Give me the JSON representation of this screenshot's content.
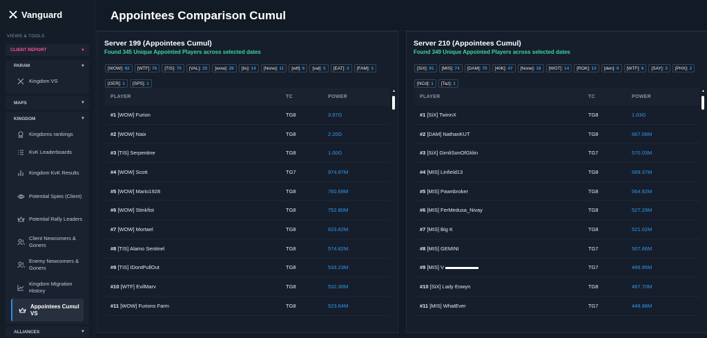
{
  "app": {
    "name": "Vanguard"
  },
  "sidebar": {
    "section_title": "VIEWS & TOOLS",
    "client_report": "CLIENT REPORT",
    "param": {
      "label": "PARAM",
      "items": [
        {
          "label": "Kingdom VS",
          "icon": "swords-icon"
        }
      ]
    },
    "maps": {
      "label": "MAPS"
    },
    "kingdom": {
      "label": "KINGDOM",
      "items": [
        {
          "label": "Kingdoms rankings",
          "icon": "award-icon"
        },
        {
          "label": "KvK Leaderboards",
          "icon": "list-icon"
        },
        {
          "label": "Kingdom KvK Results",
          "icon": "bar-chart-icon"
        },
        {
          "label": "Potential Spies (Client)",
          "icon": "eye-icon"
        },
        {
          "label": "Potential Rally Leaders",
          "icon": "crown-icon"
        },
        {
          "label": "Client Newcomers & Goners",
          "icon": "users-icon"
        },
        {
          "label": "Enemy Newcomers & Goners",
          "icon": "users-icon"
        },
        {
          "label": "Kingdom Migration History",
          "icon": "trend-icon"
        },
        {
          "label": "Appointees Cumul VS",
          "icon": "crown-icon",
          "active": true
        }
      ]
    },
    "alliances": {
      "label": "ALLIANCES"
    }
  },
  "header": {
    "title": "Appointees Comparison Cumul"
  },
  "columns": {
    "player": "PLAYER",
    "tc": "TC",
    "power": "POWER"
  },
  "panels": [
    {
      "title": "Server 199 (Appointees Cumul)",
      "found": "Found 345 Unique Appointed Players across selected dates",
      "tags": [
        {
          "name": "[WOW]:",
          "count": "92"
        },
        {
          "name": "[WTF]:",
          "count": "76"
        },
        {
          "name": "[TIS]:",
          "count": "70"
        },
        {
          "name": "[VAL]:",
          "count": "35"
        },
        {
          "name": "[wow]:",
          "count": "28"
        },
        {
          "name": "[tis]:",
          "count": "14"
        },
        {
          "name": "[None]:",
          "count": "11"
        },
        {
          "name": "[wtf]:",
          "count": "6"
        },
        {
          "name": "[val]:",
          "count": "5"
        },
        {
          "name": "[EAT]:",
          "count": "3"
        },
        {
          "name": "[FAM]:",
          "count": "3"
        },
        {
          "name": "[GER]:",
          "count": "1"
        },
        {
          "name": "[SPS]:",
          "count": "1"
        }
      ],
      "rows": [
        {
          "rank": "#1",
          "name": "[WOW] Furion",
          "tc": "TG8",
          "power": "3.97G"
        },
        {
          "rank": "#2",
          "name": "[WOW] Naix",
          "tc": "TG8",
          "power": "2.20G"
        },
        {
          "rank": "#3",
          "name": "[TIS] Serpentine",
          "tc": "TG8",
          "power": "1.00G"
        },
        {
          "rank": "#4",
          "name": "[WOW] Scott",
          "tc": "TG7",
          "power": "974.87M"
        },
        {
          "rank": "#5",
          "name": "[WOW] Mario1928",
          "tc": "TG8",
          "power": "760.69M"
        },
        {
          "rank": "#6",
          "name": "[WOW] Stinkfist",
          "tc": "TG8",
          "power": "752.80M"
        },
        {
          "rank": "#7",
          "name": "[WOW] Mortael",
          "tc": "TG8",
          "power": "623.82M"
        },
        {
          "rank": "#8",
          "name": "[TIS] Alamo Sentinel",
          "tc": "TG8",
          "power": "574.82M"
        },
        {
          "rank": "#9",
          "name": "[TIS] IDontPullOut",
          "tc": "TG8",
          "power": "533.23M"
        },
        {
          "rank": "#10",
          "name": "[WTF] EvilMarv",
          "tc": "TG8",
          "power": "532.30M"
        },
        {
          "rank": "#11",
          "name": "[WOW] Furions Farm",
          "tc": "TG8",
          "power": "523.64M"
        }
      ]
    },
    {
      "title": "Server 210 (Appointees Cumul)",
      "found": "Found 349 Unique Appointed Players across selected dates",
      "tags": [
        {
          "name": "[SiX]:",
          "count": "91"
        },
        {
          "name": "[MIS]:",
          "count": "74"
        },
        {
          "name": "[DAM]:",
          "count": "70"
        },
        {
          "name": "[40K]:",
          "count": "47"
        },
        {
          "name": "[None]:",
          "count": "18"
        },
        {
          "name": "[WOT]:",
          "count": "14"
        },
        {
          "name": "[ROK]:",
          "count": "13"
        },
        {
          "name": "[den]:",
          "count": "9"
        },
        {
          "name": "[WTF]:",
          "count": "6"
        },
        {
          "name": "[SAY]:",
          "count": "3"
        },
        {
          "name": "[PHX]:",
          "count": "2"
        },
        {
          "name": "[NCd]:",
          "count": "1"
        },
        {
          "name": "[Taz]:",
          "count": "1"
        }
      ],
      "rows": [
        {
          "rank": "#1",
          "name": "[SiX] TwinnX",
          "tc": "TG8",
          "power": "1.03G"
        },
        {
          "rank": "#2",
          "name": "[DAM] NathanKUT",
          "tc": "TG8",
          "power": "667.08M"
        },
        {
          "rank": "#3",
          "name": "[SiX] GimliSonOfGlóin",
          "tc": "TG7",
          "power": "570.03M"
        },
        {
          "rank": "#4",
          "name": "[MIS] Linfield13",
          "tc": "TG8",
          "power": "569.37M"
        },
        {
          "rank": "#5",
          "name": "[MIS] Pawnbroker",
          "tc": "TG8",
          "power": "564.92M"
        },
        {
          "rank": "#6",
          "name": "[MIS] FerMedusa_Nivay",
          "tc": "TG8",
          "power": "527.29M"
        },
        {
          "rank": "#7",
          "name": "[MIS] Big K",
          "tc": "TG8",
          "power": "521.02M"
        },
        {
          "rank": "#8",
          "name": "[MIS] GEMINI",
          "tc": "TG7",
          "power": "507.66M"
        },
        {
          "rank": "#9",
          "name": "[MIS] V",
          "tc": "TG7",
          "power": "499.95M"
        },
        {
          "rank": "#10",
          "name": "[SiX] Lady Eowyn",
          "tc": "TG8",
          "power": "467.70M"
        },
        {
          "rank": "#11",
          "name": "[MIS] WhatEver",
          "tc": "TG7",
          "power": "449.88M"
        }
      ]
    }
  ]
}
